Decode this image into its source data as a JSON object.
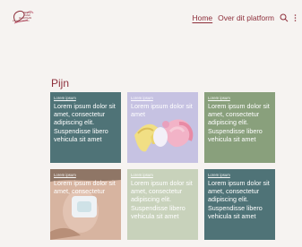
{
  "header": {
    "logo_text": [
      "VERTEL",
      "OVER",
      "JE LICHAAM",
      "EN JE GEVOELENS"
    ],
    "nav": {
      "home": "Home",
      "about": "Over dit platform"
    },
    "icons": {
      "search": "search-icon",
      "more": "more-vertical-icon"
    }
  },
  "page": {
    "title": "Pijn"
  },
  "cards": [
    {
      "meta": "Lorem ipsum",
      "text": "Lorem ipsum dolor sit amet, consectetur adipiscing elit. Suspendisse libero vehicula sit amet",
      "bg": "#4f7377",
      "image": ""
    },
    {
      "meta": "Lorem ipsum",
      "text": "Lorem ipsum dolor sit amet",
      "bg": "#c6c2e2",
      "image": "toy-objects-photo"
    },
    {
      "meta": "Lorem ipsum",
      "text": "Lorem ipsum dolor sit amet, consectetur adipiscing elit. Suspendisse libero vehicula sit amet",
      "bg": "#89a07c",
      "image": ""
    },
    {
      "meta": "Lorem ipsum",
      "text": "Lorem ipsum dolor sit amet, consectetur",
      "bg": "#d7b9a3",
      "image": "skin-patch-photo"
    },
    {
      "meta": "Lorem ipsum",
      "text": "Lorem ipsum dolor sit amet, consectetur adipiscing elit. Suspendisse libero vehicula sit amet",
      "bg": "#c8d2bb",
      "image": ""
    },
    {
      "meta": "Lorem ipsum",
      "text": "Lorem ipsum dolor sit amet, consectetur adipiscing elit. Suspendisse libero vehicula sit amet",
      "bg": "#4f7377",
      "image": ""
    }
  ],
  "colors": {
    "accent": "#8d2e3a",
    "background": "#f6f3f1"
  }
}
